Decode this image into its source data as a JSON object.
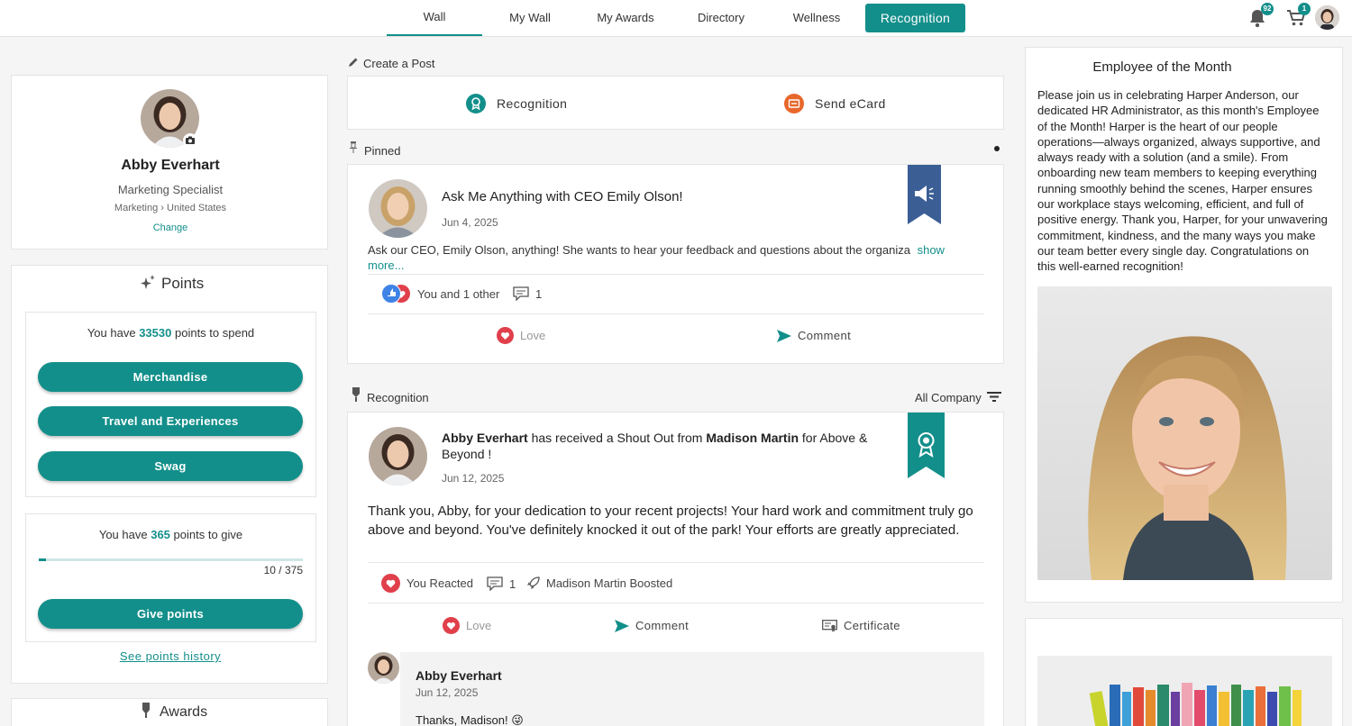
{
  "nav": {
    "tabs": [
      "Wall",
      "My Wall",
      "My Awards",
      "Directory",
      "Wellness"
    ],
    "active_button": "Recognition",
    "notifications_count": "92",
    "cart_count": "1"
  },
  "profile": {
    "name": "Abby Everhart",
    "title": "Marketing Specialist",
    "department": "Marketing",
    "country": "United States",
    "change_link": "Change"
  },
  "points": {
    "heading": "Points",
    "spend_prefix": "You have",
    "spend_value": "33530",
    "spend_suffix": "points to spend",
    "buttons": [
      "Merchandise",
      "Travel and Experiences",
      "Swag"
    ],
    "give_prefix": "You have",
    "give_value": "365",
    "give_suffix": "points to give",
    "progress_text": "10 / 375",
    "progress_fraction": 0.027,
    "give_button": "Give points",
    "history_link": "See points history"
  },
  "awards": {
    "heading": "Awards"
  },
  "create_post": {
    "label": "Create a Post",
    "recognition": "Recognition",
    "ecard": "Send eCard"
  },
  "pinned": {
    "label": "Pinned",
    "title": "Ask Me Anything with CEO Emily Olson!",
    "date": "Jun 4, 2025",
    "body": "Ask our CEO, Emily Olson, anything! She wants to hear your feedback and questions about the organiza",
    "show_more_1": "show",
    "show_more_2": "more...",
    "reactions": "You and 1 other",
    "comments": "1",
    "love": "Love",
    "comment": "Comment"
  },
  "recognition_feed": {
    "label": "Recognition",
    "filter": "All Company",
    "receiver": "Abby Everhart",
    "mid_text": "has received a Shout Out from",
    "giver": "Madison Martin",
    "reason_text_1": "for Above &",
    "reason_text_2": "Beyond !",
    "date": "Jun 12, 2025",
    "message_line_1": "Thank you, Abby, for your dedication to your recent projects! Your hard work and commitment truly go",
    "message_line_2": "above and beyond. You've definitely knocked it out of the park! Your efforts are greatly appreciated.",
    "reacted": "You Reacted",
    "comments": "1",
    "boosted": "Madison Martin Boosted",
    "love": "Love",
    "comment": "Comment",
    "certificate": "Certificate",
    "reply_author": "Abby Everhart",
    "reply_date": "Jun 12, 2025",
    "reply_text": "Thanks, Madison! 😜"
  },
  "employee_of_month": {
    "heading": "Employee of the Month",
    "lines": [
      "Please join us in celebrating Harper Anderson, our",
      "dedicated HR Administrator, as this month's Employee",
      "of the Month! Harper is the heart of our people",
      "operations—always organized, always supportive, and",
      "always ready with a solution (and a smile). From",
      "onboarding new team members to keeping everything",
      "running smoothly behind the scenes, Harper ensures",
      "our workplace stays welcoming, efficient, and full of",
      "positive energy. Thank you, Harper, for your unwavering",
      "commitment, kindness, and the many ways you make",
      "our team better every single day. Congratulations on",
      "this well-earned recognition!"
    ]
  },
  "colors": {
    "accent": "#138f8b",
    "love": "#e0404b",
    "ecard": "#e8672a",
    "ribbon_blue": "#3b5f95"
  }
}
